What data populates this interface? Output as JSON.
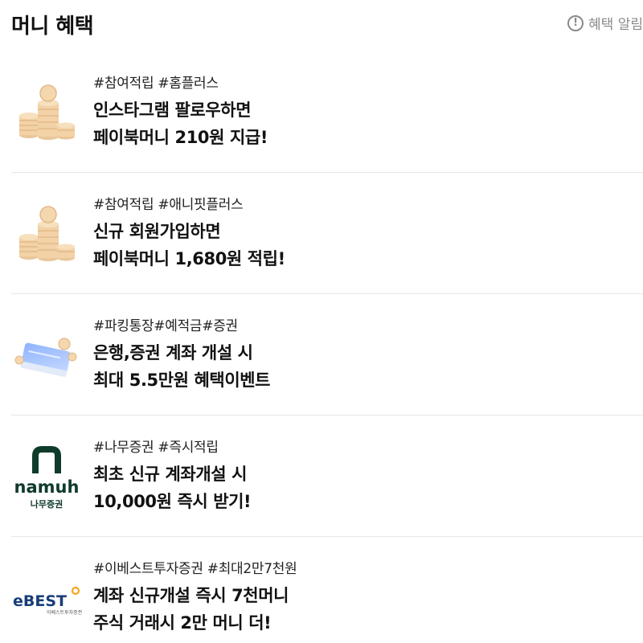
{
  "header": {
    "title": "머니 혜택",
    "alert_icon": "exclamation-circle-icon",
    "alert_label": "혜택 알림"
  },
  "items": [
    {
      "thumbnail": "coin-stack-icon",
      "tags": "#참여적립 #홈플러스",
      "line1": "인스타그램 팔로우하면",
      "line2": "페이북머니 210원 지급!"
    },
    {
      "thumbnail": "coin-stack-icon",
      "tags": "#참여적립 #애니핏플러스",
      "line1": "신규 회원가입하면",
      "line2": "페이북머니 1,680원 적립!"
    },
    {
      "thumbnail": "bankbook-coins-icon",
      "tags": "#파킹통장#예적금#증권",
      "line1": "은행,증권 계좌 개설 시",
      "line2": "최대 5.5만원 혜택이벤트"
    },
    {
      "thumbnail": "namuh-logo",
      "logo_word": "namuh",
      "logo_sub": "나무증권",
      "tags": "#나무증권 #즉시적립",
      "line1": "최초 신규 계좌개설 시",
      "line2": "10,000원 즉시 받기!"
    },
    {
      "thumbnail": "ebest-logo",
      "logo_word": "eBEST",
      "logo_sub": "이베스트투자증권",
      "tags": "#이베스트투자증권 #최대2만7천원",
      "line1": "계좌 신규개설 즉시 7천머니",
      "line2": "주식 거래시 2만 머니 더!"
    }
  ]
}
